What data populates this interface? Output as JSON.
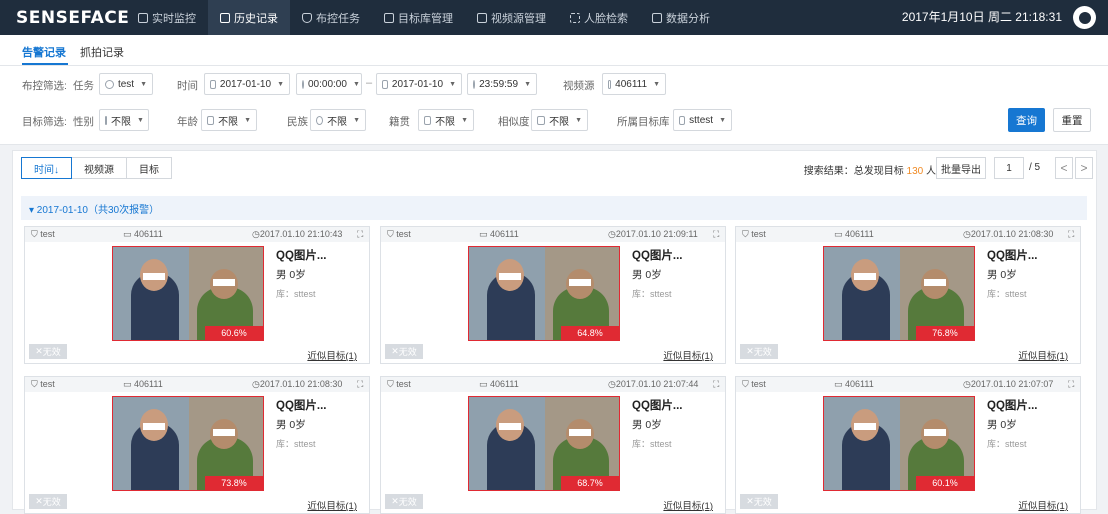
{
  "app": {
    "logo": "SENSEFACE",
    "datetime": "2017年1月10日 周二 21:18:31"
  },
  "nav": [
    {
      "label": "实时监控",
      "icon": "monitor-icon",
      "active": false
    },
    {
      "label": "历史记录",
      "icon": "history-icon",
      "active": true
    },
    {
      "label": "布控任务",
      "icon": "shield-icon",
      "active": false
    },
    {
      "label": "目标库管理",
      "icon": "library-icon",
      "active": false
    },
    {
      "label": "视频源管理",
      "icon": "video-icon",
      "active": false
    },
    {
      "label": "人脸检索",
      "icon": "face-scan-icon",
      "active": false
    },
    {
      "label": "数据分析",
      "icon": "chart-icon",
      "active": false
    }
  ],
  "sub_tabs": [
    {
      "label": "告警记录",
      "active": true
    },
    {
      "label": "抓拍记录",
      "active": false
    }
  ],
  "filters": {
    "row1": {
      "label": "布控筛选:",
      "task_label": "任务",
      "task_value": "test",
      "time_label": "时间",
      "start_date": "2017-01-10",
      "start_time": "00:00:00",
      "end_date": "2017-01-10",
      "end_time": "23:59:59",
      "source_label": "视频源",
      "source_value": "406111"
    },
    "row2": {
      "label": "目标筛选:",
      "gender_label": "性别",
      "gender_value": "不限",
      "age_label": "年龄",
      "age_value": "不限",
      "ethnic_label": "民族",
      "ethnic_value": "不限",
      "native_label": "籍贯",
      "native_value": "不限",
      "similarity_label": "相似度",
      "similarity_value": "不限",
      "lib_label": "所属目标库",
      "lib_value": "sttest"
    },
    "query_label": "查询",
    "reset_label": "重置"
  },
  "results": {
    "sort_buttons": [
      "时间↓",
      "视频源",
      "目标"
    ],
    "summary_prefix": "搜索结果：总发现目标",
    "summary_count": "130",
    "summary_suffix": "人",
    "export_label": "批量导出",
    "page_current": "1",
    "page_total": "/ 5",
    "prev_label": "<",
    "next_label": ">",
    "group_header": "▾ 2017-01-10（共30次报警）"
  },
  "cards": [
    {
      "task": "test",
      "source": "406111",
      "time": "2017.01.10 21:10:43",
      "name": "QQ图片...",
      "gender_age": "男 0岁",
      "library": "库：sttest",
      "score": "60.6%",
      "invalid": "无效",
      "similar": "近似目标(1)"
    },
    {
      "task": "test",
      "source": "406111",
      "time": "2017.01.10 21:09:11",
      "name": "QQ图片...",
      "gender_age": "男 0岁",
      "library": "库：sttest",
      "score": "64.8%",
      "invalid": "无效",
      "similar": "近似目标(1)"
    },
    {
      "task": "test",
      "source": "406111",
      "time": "2017.01.10 21:08:30",
      "name": "QQ图片...",
      "gender_age": "男 0岁",
      "library": "库：sttest",
      "score": "76.8%",
      "invalid": "无效",
      "similar": "近似目标(1)"
    },
    {
      "task": "test",
      "source": "406111",
      "time": "2017.01.10 21:08:30",
      "name": "QQ图片...",
      "gender_age": "男 0岁",
      "library": "库：sttest",
      "score": "73.8%",
      "invalid": "无效",
      "similar": "近似目标(1)"
    },
    {
      "task": "test",
      "source": "406111",
      "time": "2017.01.10 21:07:44",
      "name": "QQ图片...",
      "gender_age": "男 0岁",
      "library": "库：sttest",
      "score": "68.7%",
      "invalid": "无效",
      "similar": "近似目标(1)"
    },
    {
      "task": "test",
      "source": "406111",
      "time": "2017.01.10 21:07:07",
      "name": "QQ图片...",
      "gender_age": "男 0岁",
      "library": "库：sttest",
      "score": "60.1%",
      "invalid": "无效",
      "similar": "近似目标(1)"
    }
  ],
  "colors": {
    "topbar": "#1f2d3d",
    "accent": "#1677d2",
    "alert": "#e02a33",
    "count": "#f08a24"
  }
}
